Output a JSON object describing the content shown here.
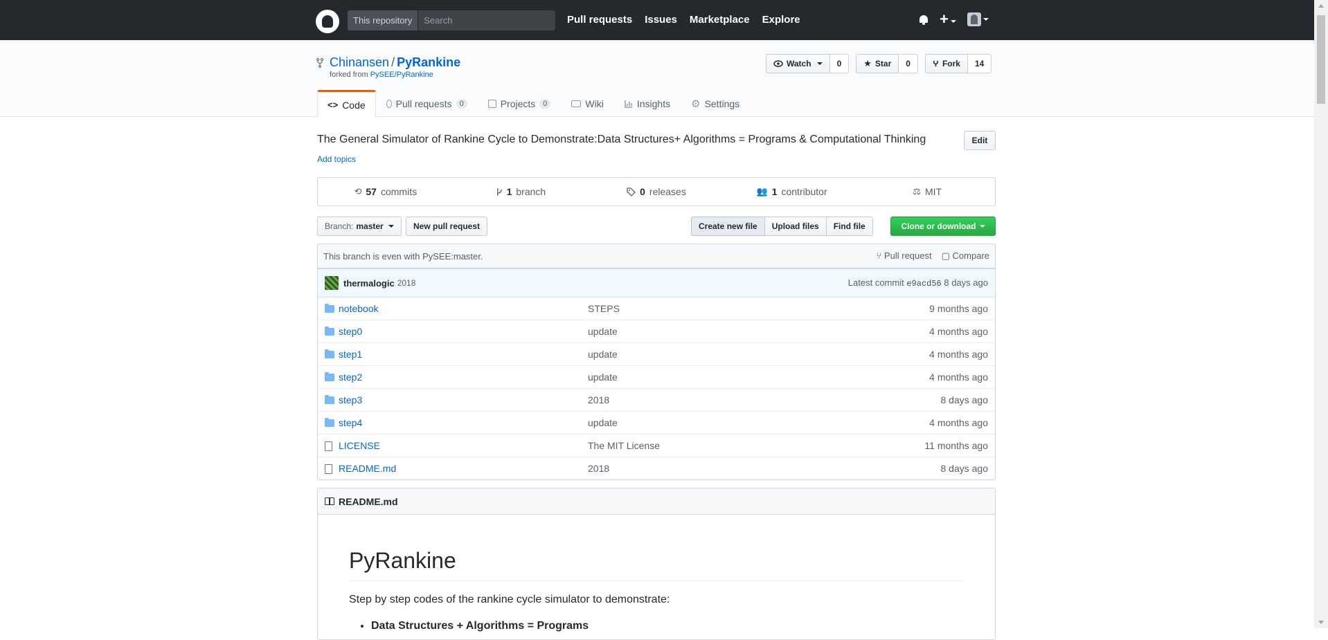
{
  "header": {
    "search_scope": "This repository",
    "search_placeholder": "Search",
    "nav": [
      "Pull requests",
      "Issues",
      "Marketplace",
      "Explore"
    ]
  },
  "repo": {
    "owner": "Chinansen",
    "separator": "/",
    "name": "PyRankine",
    "forked_prefix": "forked from",
    "forked_from": "PySEE/PyRankine",
    "watch_label": "Watch",
    "watch_count": "0",
    "star_label": "Star",
    "star_count": "0",
    "fork_label": "Fork",
    "fork_count": "14"
  },
  "tabs": [
    {
      "label": "Code",
      "count": null,
      "icon": "code-icon"
    },
    {
      "label": "Pull requests",
      "count": "0",
      "icon": "git-pull-request-icon"
    },
    {
      "label": "Projects",
      "count": "0",
      "icon": "project-icon"
    },
    {
      "label": "Wiki",
      "count": null,
      "icon": "book-icon"
    },
    {
      "label": "Insights",
      "count": null,
      "icon": "graph-icon"
    },
    {
      "label": "Settings",
      "count": null,
      "icon": "gear-icon"
    }
  ],
  "description": "The General Simulator of Rankine Cycle to Demonstrate:Data Structures+ Algorithms = Programs & Computational Thinking",
  "add_topics": "Add topics",
  "edit_label": "Edit",
  "summary": {
    "commits_num": "57",
    "commits_label": "commits",
    "branch_num": "1",
    "branch_label": "branch",
    "releases_num": "0",
    "releases_label": "releases",
    "contributor_num": "1",
    "contributor_label": "contributor",
    "license": "MIT"
  },
  "file_nav": {
    "branch_prefix": "Branch:",
    "branch_name": "master",
    "new_pr": "New pull request",
    "create_file": "Create new file",
    "upload_files": "Upload files",
    "find_file": "Find file",
    "clone": "Clone or download"
  },
  "branch_info": {
    "text": "This branch is even with PySEE:master.",
    "pull_request": "Pull request",
    "compare": "Compare"
  },
  "latest_commit": {
    "author": "thermalogic",
    "message": "2018",
    "label": "Latest commit",
    "sha": "e9acd56",
    "age": "8 days ago"
  },
  "files": [
    {
      "type": "dir",
      "name": "notebook",
      "message": "STEPS",
      "age": "9 months ago"
    },
    {
      "type": "dir",
      "name": "step0",
      "message": "update",
      "age": "4 months ago"
    },
    {
      "type": "dir",
      "name": "step1",
      "message": "update",
      "age": "4 months ago"
    },
    {
      "type": "dir",
      "name": "step2",
      "message": "update",
      "age": "4 months ago"
    },
    {
      "type": "dir",
      "name": "step3",
      "message": "2018",
      "age": "8 days ago"
    },
    {
      "type": "dir",
      "name": "step4",
      "message": "update",
      "age": "4 months ago"
    },
    {
      "type": "file",
      "name": "LICENSE",
      "message": "The MIT License",
      "age": "11 months ago"
    },
    {
      "type": "file",
      "name": "README.md",
      "message": "2018",
      "age": "8 days ago"
    }
  ],
  "readme": {
    "filename": "README.md",
    "title": "PyRankine",
    "intro": "Step by step codes of the rankine cycle simulator to demonstrate:",
    "bullet1": "Data Structures + Algorithms = Programs"
  }
}
